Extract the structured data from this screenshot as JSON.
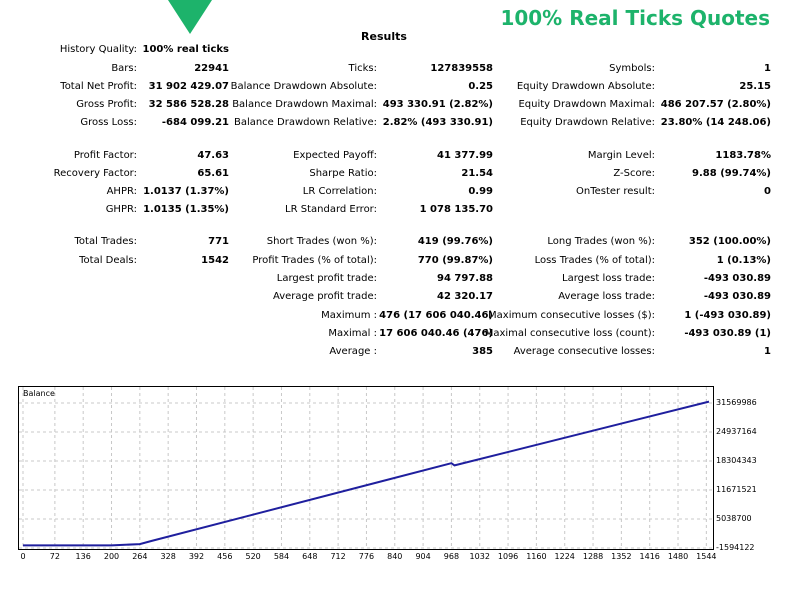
{
  "promo_text": "100% Real Ticks Quotes",
  "title": "Results",
  "colors": {
    "accent": "#1db36b",
    "line": "#1f1f9e",
    "grid": "#c8c8c8"
  },
  "col1": [
    {
      "label": "History Quality:",
      "value": "100% real ticks"
    },
    {
      "label": "Bars:",
      "value": "22941"
    },
    {
      "label": "Total Net Profit:",
      "value": "31 902 429.07"
    },
    {
      "label": "Gross Profit:",
      "value": "32 586 528.28"
    },
    {
      "label": "Gross Loss:",
      "value": "-684 099.21"
    },
    {
      "label": "Profit Factor:",
      "value": "47.63"
    },
    {
      "label": "Recovery Factor:",
      "value": "65.61"
    },
    {
      "label": "AHPR:",
      "value": "1.0137 (1.37%)"
    },
    {
      "label": "GHPR:",
      "value": "1.0135 (1.35%)"
    },
    {
      "label": "Total Trades:",
      "value": "771"
    },
    {
      "label": "Total Deals:",
      "value": "1542"
    }
  ],
  "col2": [
    {
      "label": "Ticks:",
      "value": "127839558"
    },
    {
      "label": "Balance Drawdown Absolute:",
      "value": "0.25"
    },
    {
      "label": "Balance Drawdown Maximal:",
      "value": "493 330.91 (2.82%)"
    },
    {
      "label": "Balance Drawdown Relative:",
      "value": "2.82% (493 330.91)"
    },
    {
      "label": "Expected Payoff:",
      "value": "41 377.99"
    },
    {
      "label": "Sharpe Ratio:",
      "value": "21.54"
    },
    {
      "label": "LR Correlation:",
      "value": "0.99"
    },
    {
      "label": "LR Standard Error:",
      "value": "1 078 135.70"
    },
    {
      "label": "Short Trades (won %):",
      "value": "419 (99.76%)"
    },
    {
      "label": "Profit Trades (% of total):",
      "value": "770 (99.87%)"
    },
    {
      "label": "Largest profit trade:",
      "value": "94 797.88"
    },
    {
      "label": "Average profit trade:",
      "value": "42 320.17"
    },
    {
      "label": "Maximum :",
      "value": "476 (17 606 040.46)"
    },
    {
      "label": "Maximal :",
      "value": "17 606 040.46 (476)"
    },
    {
      "label": "Average :",
      "value": "385"
    }
  ],
  "col3": [
    {
      "label": "Symbols:",
      "value": "1"
    },
    {
      "label": "Equity Drawdown Absolute:",
      "value": "25.15"
    },
    {
      "label": "Equity Drawdown Maximal:",
      "value": "486 207.57 (2.80%)"
    },
    {
      "label": "Equity Drawdown Relative:",
      "value": "23.80% (14 248.06)"
    },
    {
      "label": "Margin Level:",
      "value": "1183.78%"
    },
    {
      "label": "Z-Score:",
      "value": "9.88 (99.74%)"
    },
    {
      "label": "OnTester result:",
      "value": "0"
    },
    {
      "label": "Long Trades (won %):",
      "value": "352 (100.00%)"
    },
    {
      "label": "Loss Trades (% of total):",
      "value": "1 (0.13%)"
    },
    {
      "label": "Largest loss trade:",
      "value": "-493 030.89"
    },
    {
      "label": "Average loss trade:",
      "value": "-493 030.89"
    },
    {
      "label": "Maximum consecutive losses ($):",
      "value": "1 (-493 030.89)"
    },
    {
      "label": "Maximal consecutive loss (count):",
      "value": "-493 030.89 (1)"
    },
    {
      "label": "Average consecutive losses:",
      "value": "1"
    }
  ],
  "chart_data": {
    "type": "line",
    "title": "Balance",
    "x_ticks": [
      "0",
      "72",
      "136",
      "200",
      "264",
      "328",
      "392",
      "456",
      "520",
      "584",
      "648",
      "712",
      "776",
      "840",
      "904",
      "968",
      "1032",
      "1096",
      "1160",
      "1224",
      "1288",
      "1352",
      "1416",
      "1480",
      "1544"
    ],
    "y_ticks": [
      "31569986",
      "24937164",
      "18304343",
      "11671521",
      "5038700",
      "-1594122"
    ],
    "xlim": [
      0,
      1550
    ],
    "ylim": [
      -1594122,
      31569986
    ],
    "series": [
      {
        "x": [
          0,
          200,
          264,
          290,
          968,
          975,
          1550
        ],
        "y": [
          -1000000,
          -1000000,
          -700000,
          0,
          17800000,
          17300000,
          31900000
        ]
      }
    ]
  }
}
